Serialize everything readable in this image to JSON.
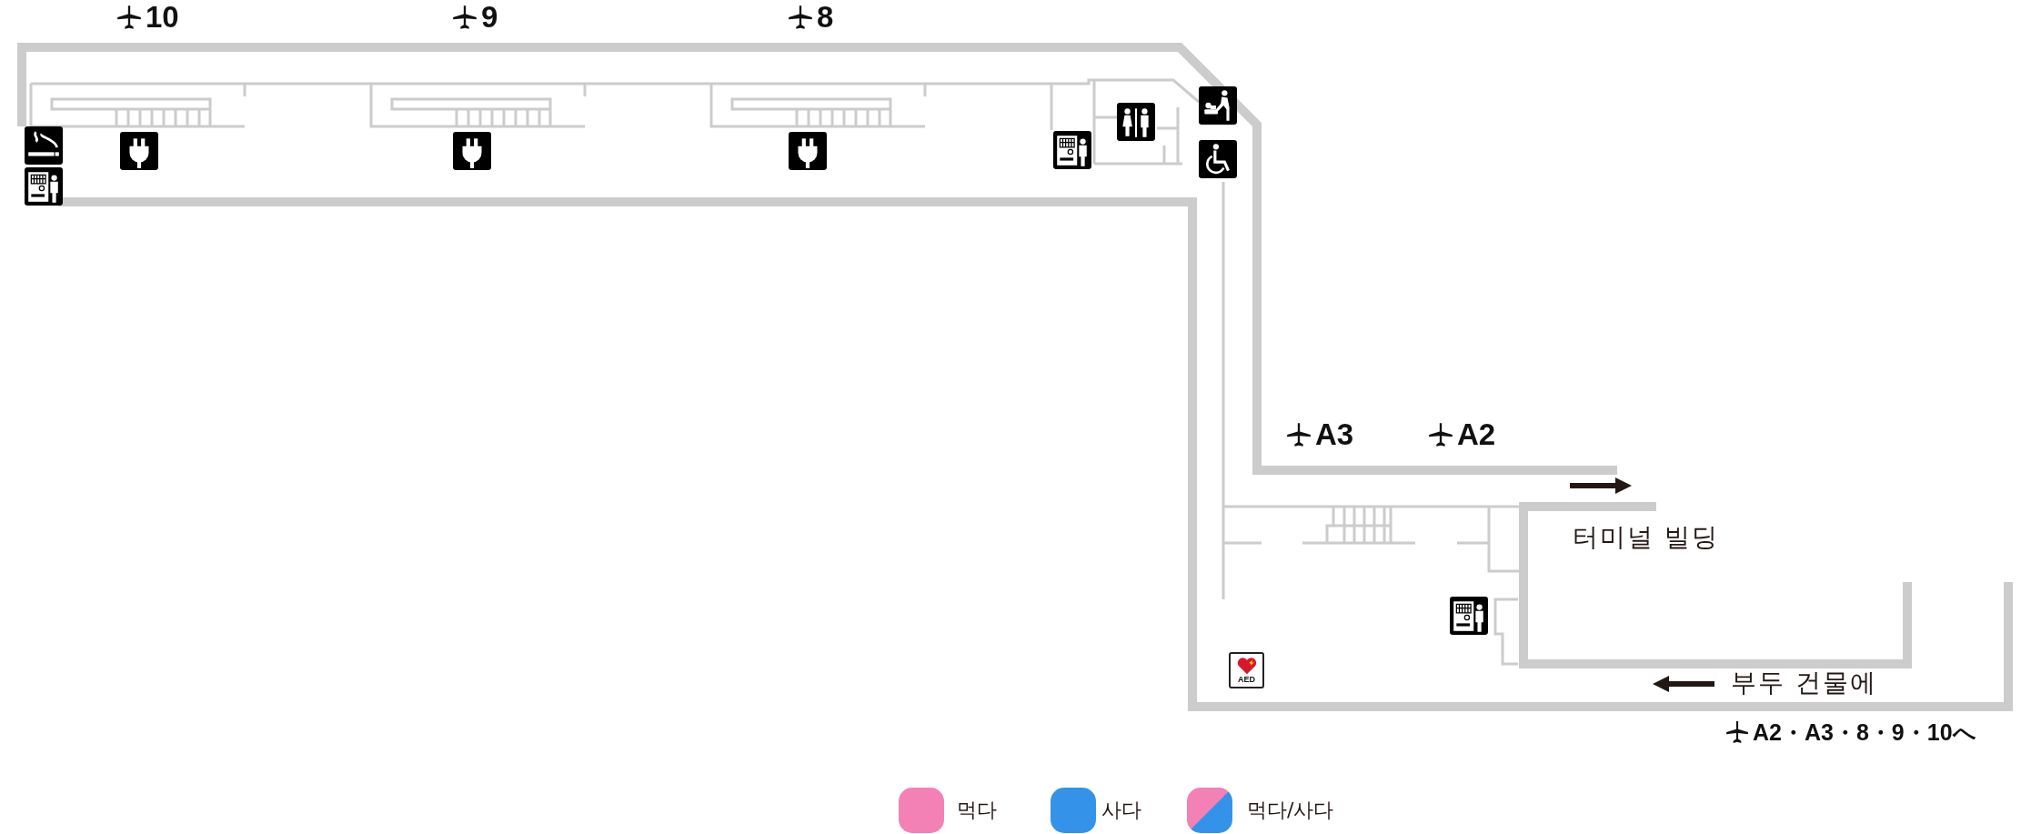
{
  "gates": [
    {
      "label": "10"
    },
    {
      "label": "9"
    },
    {
      "label": "8"
    },
    {
      "label": "A3"
    },
    {
      "label": "A2"
    }
  ],
  "areas": [
    {
      "label": "터미널 빌딩"
    },
    {
      "label": "부두 건물에"
    }
  ],
  "aed_label": "AED",
  "exit_label": "A2・A3・8・9・10へ",
  "legend": [
    {
      "kind": "solid",
      "label": "먹다",
      "color": "#f381b5"
    },
    {
      "kind": "solid",
      "label": "사다",
      "color": "#3493e8"
    },
    {
      "kind": "split",
      "label": "먹다/사다"
    }
  ]
}
